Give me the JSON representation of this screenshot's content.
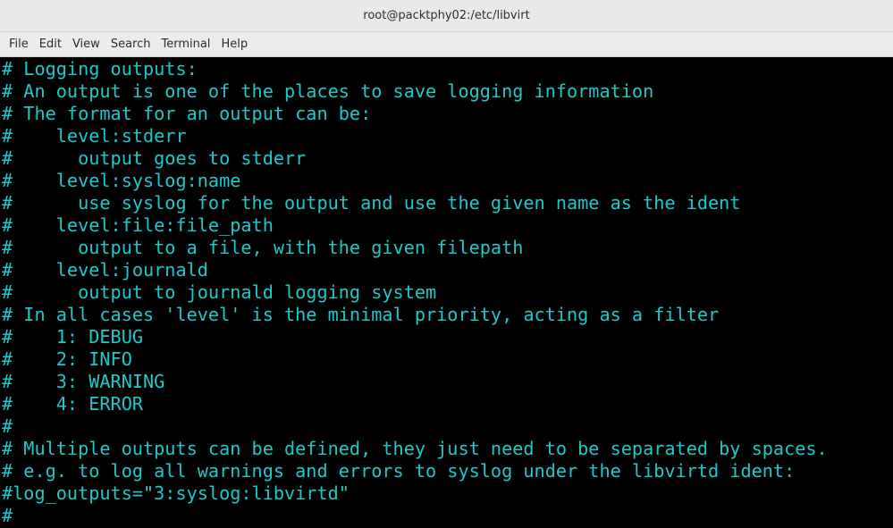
{
  "window": {
    "title": "root@packtphy02:/etc/libvirt"
  },
  "menu": [
    {
      "label": "File"
    },
    {
      "label": "Edit"
    },
    {
      "label": "View"
    },
    {
      "label": "Search"
    },
    {
      "label": "Terminal"
    },
    {
      "label": "Help"
    }
  ],
  "terminal": {
    "text_color": "#1dc9c9",
    "background_color": "#000000",
    "lines": [
      "# Logging outputs:",
      "# An output is one of the places to save logging information",
      "# The format for an output can be:",
      "#    level:stderr",
      "#      output goes to stderr",
      "#    level:syslog:name",
      "#      use syslog for the output and use the given name as the ident",
      "#    level:file:file_path",
      "#      output to a file, with the given filepath",
      "#    level:journald",
      "#      output to journald logging system",
      "# In all cases 'level' is the minimal priority, acting as a filter",
      "#    1: DEBUG",
      "#    2: INFO",
      "#    3: WARNING",
      "#    4: ERROR",
      "#",
      "# Multiple outputs can be defined, they just need to be separated by spaces.",
      "# e.g. to log all warnings and errors to syslog under the libvirtd ident:",
      "#log_outputs=\"3:syslog:libvirtd\"",
      "#"
    ]
  }
}
